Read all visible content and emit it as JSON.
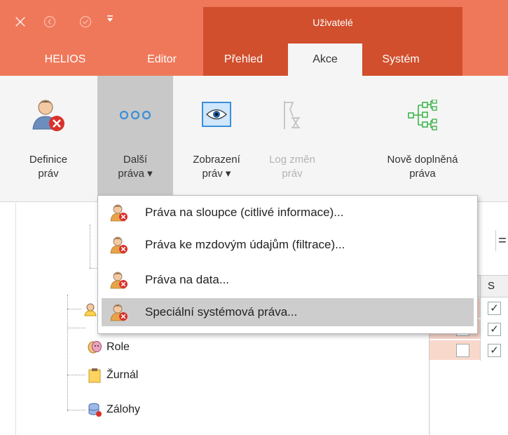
{
  "titlebar": {
    "context_title": "Uživatelé",
    "qat_icons": [
      "app-logo-icon",
      "back-icon",
      "check-icon",
      "qat-dropdown-icon"
    ]
  },
  "tabs": [
    {
      "label": "HELIOS",
      "active": false
    },
    {
      "label": "Editor",
      "active": false
    },
    {
      "label": "Přehled",
      "active": false
    },
    {
      "label": "Akce",
      "active": true
    },
    {
      "label": "Systém",
      "active": false
    }
  ],
  "ribbon": {
    "buttons": [
      {
        "line1": "Definice",
        "line2": "práv",
        "icon": "user-remove-icon",
        "state": "normal"
      },
      {
        "line1": "Další",
        "line2": "práva ▾",
        "icon": "more-dots-icon",
        "state": "pressed"
      },
      {
        "line1": "Zobrazení",
        "line2": "práv ▾",
        "icon": "eye-icon",
        "state": "normal"
      },
      {
        "line1": "Log změn",
        "line2": "práv",
        "icon": "log-icon",
        "state": "disabled"
      },
      {
        "line1": "Nově doplněná",
        "line2": "práva",
        "icon": "hierarchy-icon",
        "state": "normal"
      }
    ]
  },
  "dropdown": {
    "items": [
      {
        "label": "Práva na sloupce (citlivé informace)...",
        "icon": "user-remove-icon",
        "highlighted": false
      },
      {
        "label": "Práva ke mzdovým údajům (filtrace)...",
        "icon": "user-remove-icon",
        "highlighted": false
      },
      {
        "label": "Práva na data...",
        "icon": "user-remove-icon",
        "highlighted": false
      },
      {
        "label": "Speciální systémová práva...",
        "icon": "user-remove-icon",
        "highlighted": true
      }
    ]
  },
  "tree": {
    "items": [
      {
        "label": "Role",
        "icon": "role-icon"
      },
      {
        "label": "Žurnál",
        "icon": "clipboard-icon"
      },
      {
        "label": "Zálohy",
        "icon": "database-icon"
      }
    ]
  },
  "grid": {
    "toolbar_symbol": "=",
    "header_label": "S",
    "rows": [
      {
        "checked": true,
        "current": true
      },
      {
        "checked": true,
        "current": false
      },
      {
        "checked": true,
        "current": false
      }
    ],
    "check_mark": "✓"
  },
  "colors": {
    "titlebar": "#f0785a",
    "context_tab": "#d14f2d",
    "ribbon": "#f5f5f5",
    "row_highlight": "#f9d8cc"
  }
}
